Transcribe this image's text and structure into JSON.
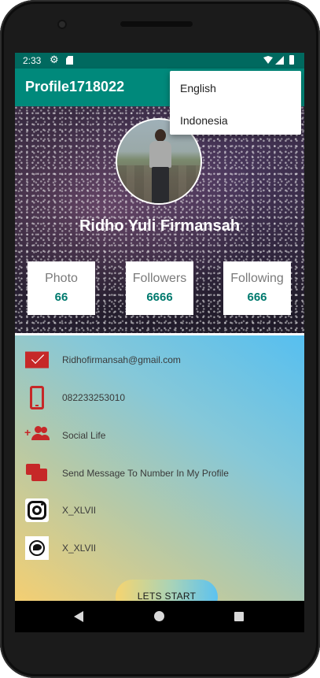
{
  "status_bar": {
    "time": "2:33",
    "icons": [
      "gear-icon",
      "sd-card-icon",
      "wifi-icon",
      "signal-icon",
      "battery-icon"
    ]
  },
  "app_bar": {
    "title": "Profile1718022"
  },
  "overflow_menu": {
    "items": [
      "English",
      "Indonesia"
    ]
  },
  "profile": {
    "name": "Ridho Yuli Firmansah",
    "stats": [
      {
        "label": "Photo",
        "value": "66"
      },
      {
        "label": "Followers",
        "value": "6666"
      },
      {
        "label": "Following",
        "value": "666"
      }
    ]
  },
  "info_rows": [
    {
      "icon": "mail-icon",
      "text": "Ridhofirmansah@gmail.com"
    },
    {
      "icon": "smartphone-icon",
      "text": "082233253010"
    },
    {
      "icon": "group-add-icon",
      "text": "Social Life"
    },
    {
      "icon": "chat-icon",
      "text": "Send Message To Number In My Profile"
    },
    {
      "icon": "instagram-icon",
      "text": "X_XLVII"
    },
    {
      "icon": "twitter-icon",
      "text": "X_XLVII"
    }
  ],
  "start_button": {
    "label": "LETS START"
  },
  "nav_bar": {
    "icons": [
      "back-icon",
      "home-icon",
      "recents-icon"
    ]
  },
  "colors": {
    "status_bar": "#00695f",
    "app_bar": "#00897b",
    "stat_value": "#007a6e",
    "icon_red": "#c62828"
  }
}
